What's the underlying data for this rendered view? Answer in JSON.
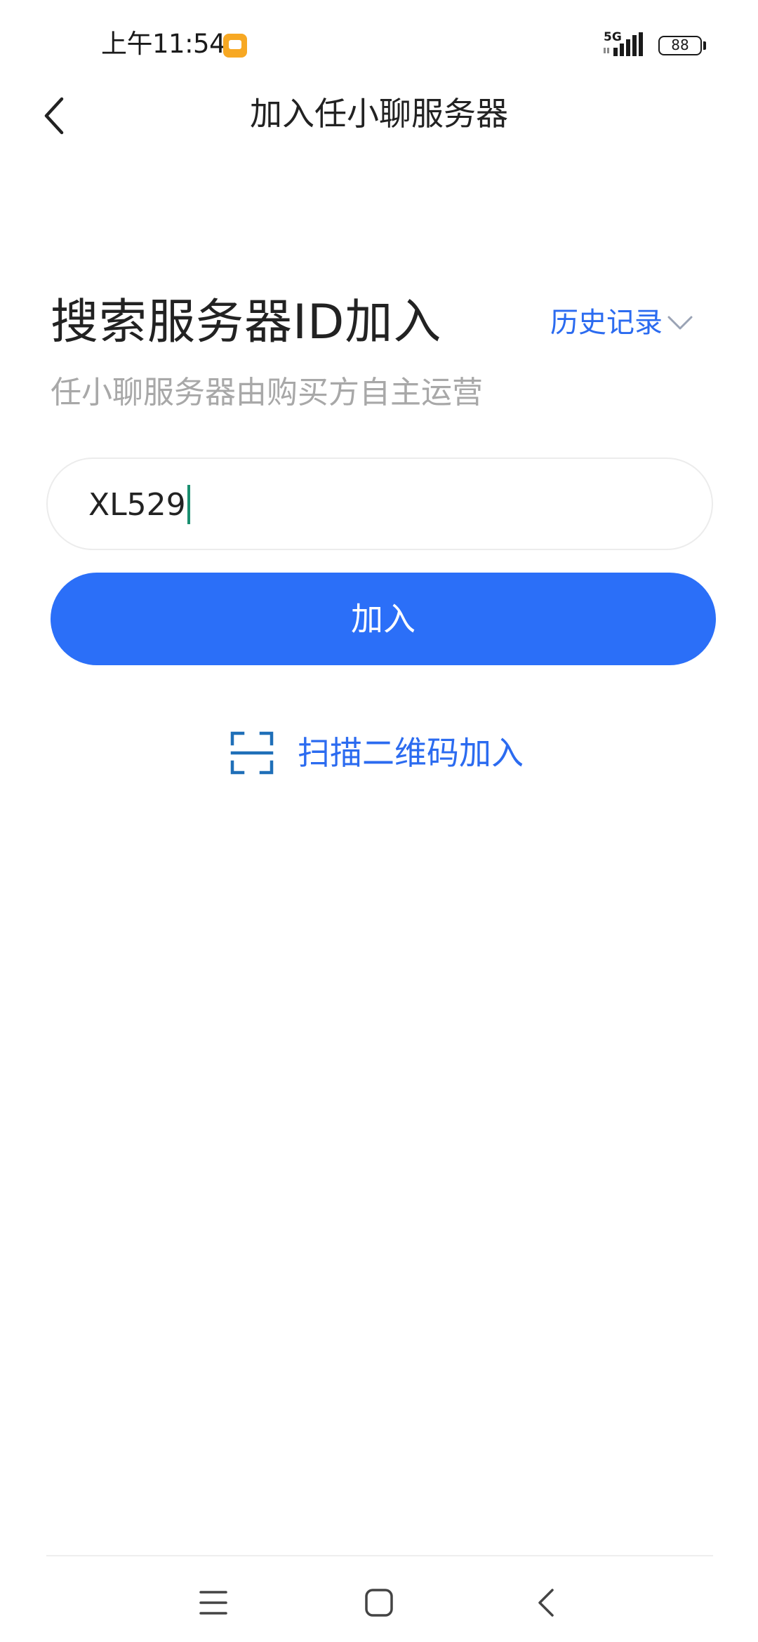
{
  "status_bar": {
    "time": "上午11:54",
    "network_type": "5G",
    "battery_level": "88",
    "icons": [
      "notification-icon",
      "signal-icon",
      "battery-icon"
    ]
  },
  "nav": {
    "title": "加入任小聊服务器",
    "back_icon": "chevron-left-icon"
  },
  "main": {
    "heading": "搜索服务器ID加入",
    "history_label": "历史记录",
    "history_icon": "chevron-down-icon",
    "subheading": "任小聊服务器由购买方自主运营",
    "search": {
      "value": "XL529",
      "placeholder": ""
    },
    "join_button_label": "加入",
    "scan_label": "扫描二维码加入",
    "scan_icon": "scan-frame-icon"
  },
  "system_nav": {
    "icons": [
      "menu-icon",
      "home-icon",
      "back-icon"
    ]
  },
  "colors": {
    "accent": "#2b6ff8",
    "link": "#2b6bf0",
    "caret": "#1a8f70",
    "subtext": "#a8a8a8"
  }
}
